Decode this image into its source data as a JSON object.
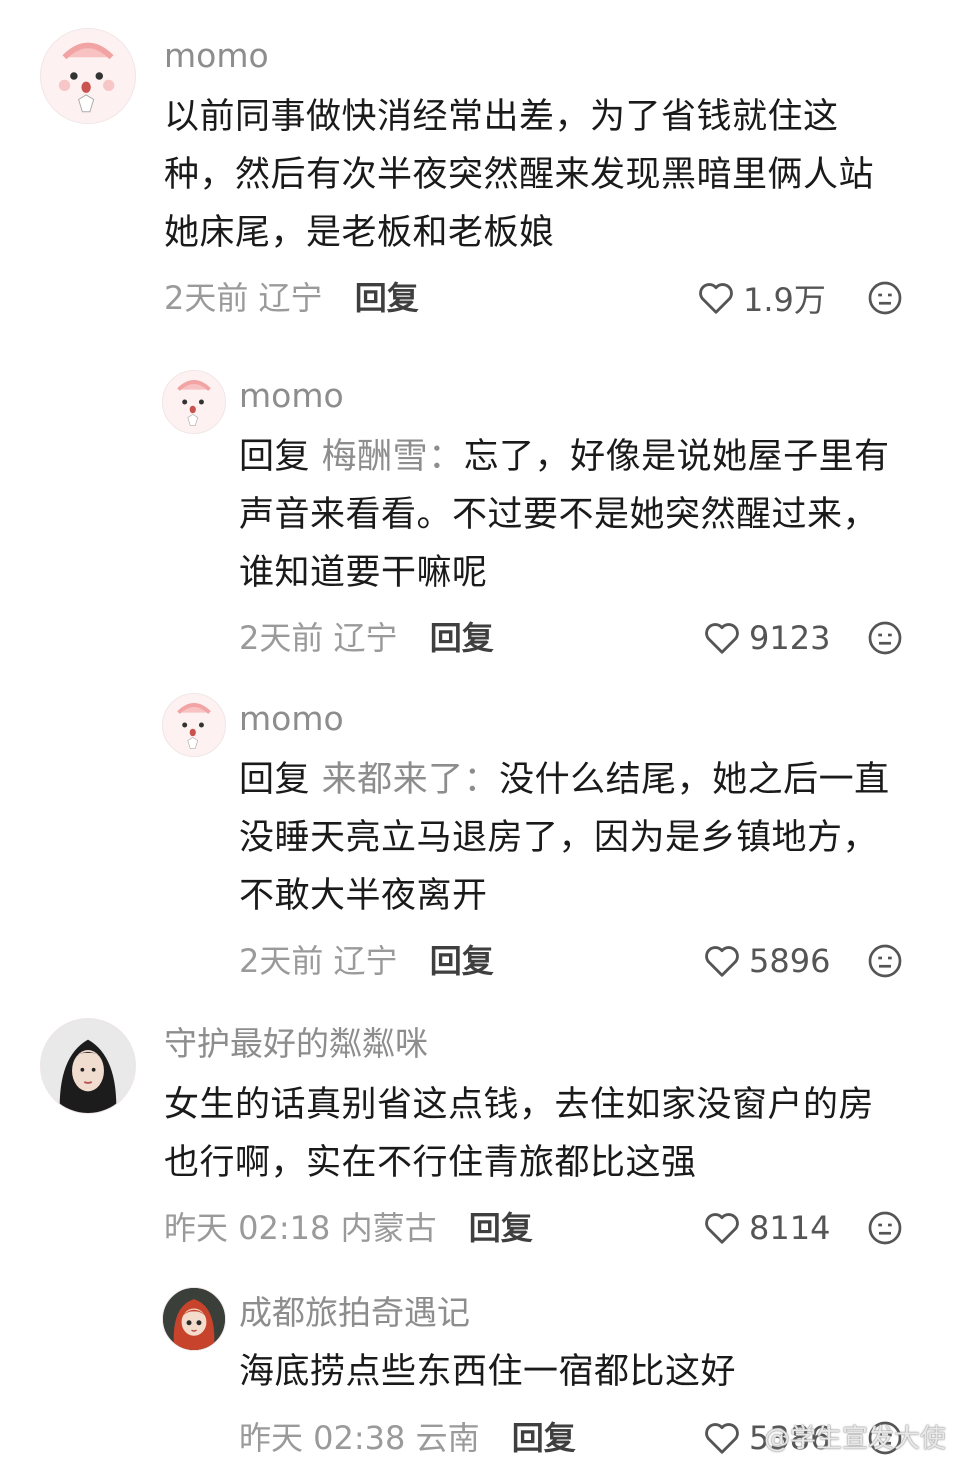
{
  "comments": [
    {
      "user": "momo",
      "text": "以前同事做快消经常出差，为了省钱就住这种，然后有次半夜突然醒来发现黑暗里俩人站她床尾，是老板和老板娘",
      "time": "2天前",
      "location": "辽宁",
      "reply_label": "回复",
      "likes": "1.9万"
    },
    {
      "user": "momo",
      "reply_prefix": "回复",
      "reply_to": "梅酬雪：",
      "text": "忘了，好像是说她屋子里有声音来看看。不过要不是她突然醒过来，谁知道要干嘛呢",
      "time": "2天前",
      "location": "辽宁",
      "reply_label": "回复",
      "likes": "9123"
    },
    {
      "user": "momo",
      "reply_prefix": "回复",
      "reply_to": "来都来了：",
      "text": "没什么结尾，她之后一直没睡天亮立马退房了，因为是乡镇地方，不敢大半夜离开",
      "time": "2天前",
      "location": "辽宁",
      "reply_label": "回复",
      "likes": "5896"
    },
    {
      "user": "守护最好的粼粼咪",
      "text": "女生的话真别省这点钱，去住如家没窗户的房也行啊，实在不行住青旅都比这强",
      "time": "昨天 02:18",
      "location": "内蒙古",
      "reply_label": "回复",
      "likes": "8114"
    },
    {
      "user": "成都旅拍奇遇记",
      "text": "海底捞点些东西住一宿都比这好",
      "time": "昨天 02:38",
      "location": "云南",
      "reply_label": "回复",
      "likes": "5386"
    }
  ],
  "watermark": "@学生宣发大使",
  "icons": {
    "like": "heart-outline-icon",
    "dislike": "meh-face-icon"
  }
}
